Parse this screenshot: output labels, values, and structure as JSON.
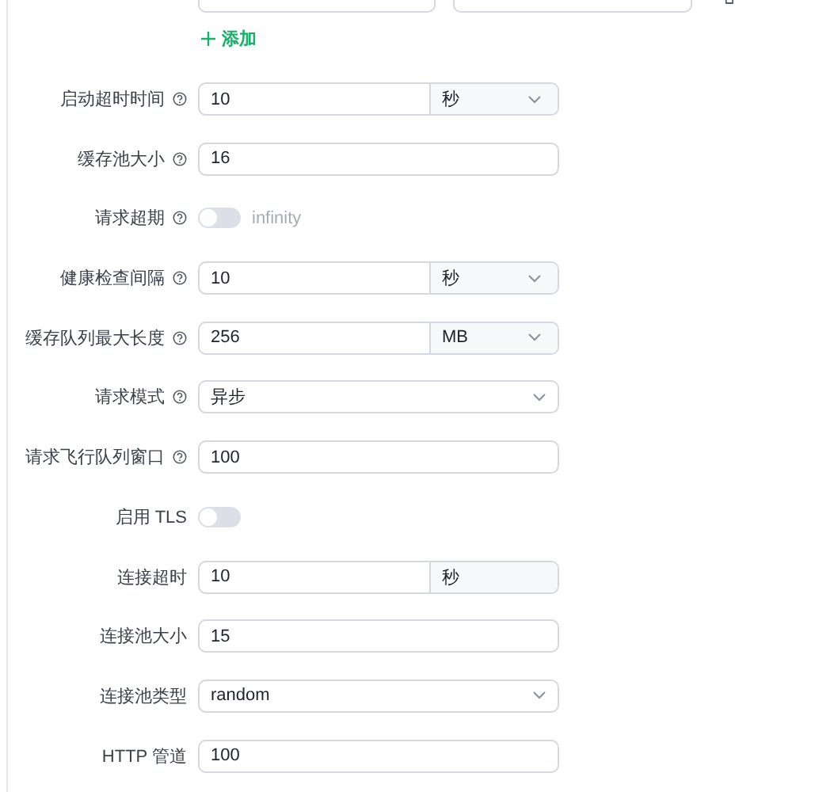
{
  "add_button": {
    "label": "添加"
  },
  "fields": [
    {
      "label": "启动超时时间",
      "help": true,
      "kind": "unit-select",
      "value": "10",
      "unit": "秒"
    },
    {
      "label": "缓存池大小",
      "help": true,
      "kind": "input",
      "value": "16"
    },
    {
      "label": "请求超期",
      "help": true,
      "kind": "switch",
      "on": false,
      "hint": "infinity"
    },
    {
      "label": "健康检查间隔",
      "help": true,
      "kind": "unit-select",
      "value": "10",
      "unit": "秒"
    },
    {
      "label": "缓存队列最大长度",
      "help": true,
      "kind": "unit-select",
      "value": "256",
      "unit": "MB"
    },
    {
      "label": "请求模式",
      "help": true,
      "kind": "select",
      "value": "异步"
    },
    {
      "label": "请求飞行队列窗口",
      "help": true,
      "kind": "input",
      "value": "100"
    },
    {
      "label": "启用 TLS",
      "help": false,
      "kind": "switch",
      "on": false
    },
    {
      "label": "连接超时",
      "help": false,
      "kind": "unit",
      "value": "10",
      "unit": "秒"
    },
    {
      "label": "连接池大小",
      "help": false,
      "kind": "input",
      "value": "15"
    },
    {
      "label": "连接池类型",
      "help": false,
      "kind": "select",
      "value": "random"
    },
    {
      "label": "HTTP 管道",
      "help": false,
      "kind": "input",
      "value": "100"
    }
  ]
}
